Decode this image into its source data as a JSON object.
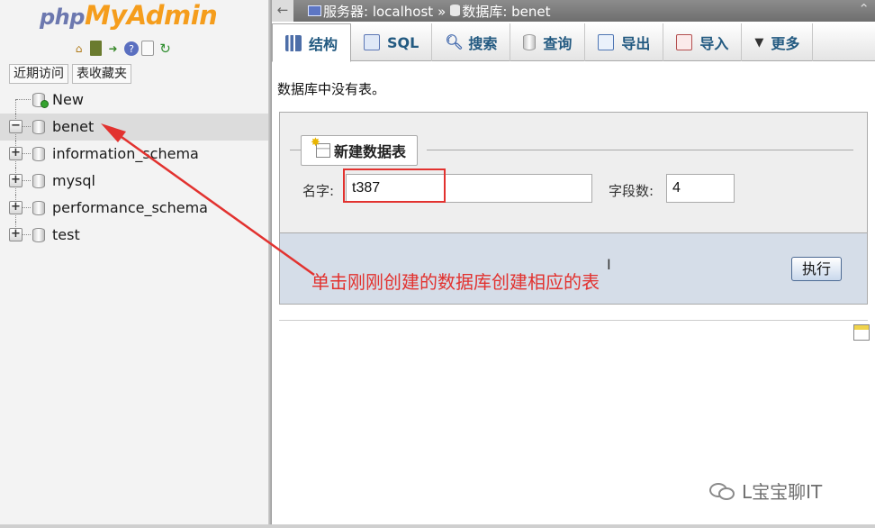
{
  "logo": {
    "part1": "php",
    "part2": "MyAdmin"
  },
  "nav": {
    "icons": [
      "home-icon",
      "sql-query-icon",
      "logout-icon",
      "help-icon",
      "documentation-icon",
      "reload-icon"
    ],
    "tabs": [
      "近期访问",
      "表收藏夹"
    ],
    "tree": [
      {
        "label": "New",
        "type": "new"
      },
      {
        "label": "benet",
        "type": "db",
        "expanded": true,
        "selected": true
      },
      {
        "label": "information_schema",
        "type": "db"
      },
      {
        "label": "mysql",
        "type": "db"
      },
      {
        "label": "performance_schema",
        "type": "db"
      },
      {
        "label": "test",
        "type": "db"
      }
    ]
  },
  "breadcrumb": {
    "server_label": "服务器: localhost",
    "separator": "»",
    "database_label": "数据库: benet"
  },
  "menu": {
    "tabs": [
      {
        "label": "结构",
        "icon": "structure-icon",
        "active": true
      },
      {
        "label": "SQL",
        "icon": "sql-icon"
      },
      {
        "label": "搜索",
        "icon": "search-icon"
      },
      {
        "label": "查询",
        "icon": "query-icon"
      },
      {
        "label": "导出",
        "icon": "export-icon"
      },
      {
        "label": "导入",
        "icon": "import-icon"
      },
      {
        "label": "更多",
        "icon": "chevron-down-icon"
      }
    ]
  },
  "main": {
    "no_tables_message": "数据库中没有表。",
    "create_table": {
      "legend": "新建数据表",
      "name_label": "名字:",
      "name_value": "t387",
      "columns_label": "字段数:",
      "columns_value": "4",
      "go_label": "执行"
    }
  },
  "annotation": {
    "text": "单击刚刚创建的数据库创建相应的表",
    "color": "#e2322f"
  },
  "watermark": {
    "text": "L宝宝聊IT"
  }
}
